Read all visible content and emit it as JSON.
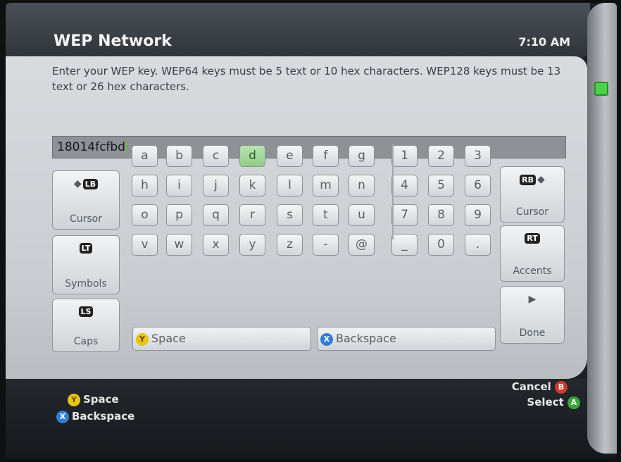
{
  "header": {
    "title": "WEP Network",
    "time": "7:10 AM"
  },
  "description": "Enter your WEP key. WEP64 keys must be 5 text or 10 hex characters. WEP128 keys must be 13 text or 26 hex characters.",
  "input": {
    "value": "18014fcfbd"
  },
  "left_buttons": [
    {
      "label": "Cursor",
      "badge": "LB",
      "icon": "arrow-left-icon"
    },
    {
      "label": "Symbols",
      "badge": "LT"
    },
    {
      "label": "Caps",
      "badge": "LS"
    }
  ],
  "right_buttons": [
    {
      "label": "Cursor",
      "badge": "RB",
      "icon": "arrow-right-icon"
    },
    {
      "label": "Accents",
      "badge": "RT"
    },
    {
      "label": "Done",
      "icon": "play-icon"
    }
  ],
  "letter_rows": [
    [
      "a",
      "b",
      "c",
      "d",
      "e",
      "f",
      "g"
    ],
    [
      "h",
      "i",
      "j",
      "k",
      "l",
      "m",
      "n"
    ],
    [
      "o",
      "p",
      "q",
      "r",
      "s",
      "t",
      "u"
    ],
    [
      "v",
      "w",
      "x",
      "y",
      "z",
      "-",
      "@"
    ]
  ],
  "number_rows": [
    [
      "1",
      "2",
      "3"
    ],
    [
      "4",
      "5",
      "6"
    ],
    [
      "7",
      "8",
      "9"
    ],
    [
      "_",
      "0",
      "."
    ]
  ],
  "selected_key": "d",
  "space_button": {
    "label": "Space",
    "glyph": "Y"
  },
  "backspace_button": {
    "label": "Backspace",
    "glyph": "X"
  },
  "footer": {
    "space_hint": "Space",
    "backspace_hint": "Backspace",
    "cancel_hint": "Cancel",
    "select_hint": "Select",
    "glyph_y": "Y",
    "glyph_x": "X",
    "glyph_b": "B",
    "glyph_a": "A"
  },
  "colors": {
    "selected_key": "#8fcf86",
    "caret": "#6bb34a",
    "accent_green": "#3aa63a"
  }
}
